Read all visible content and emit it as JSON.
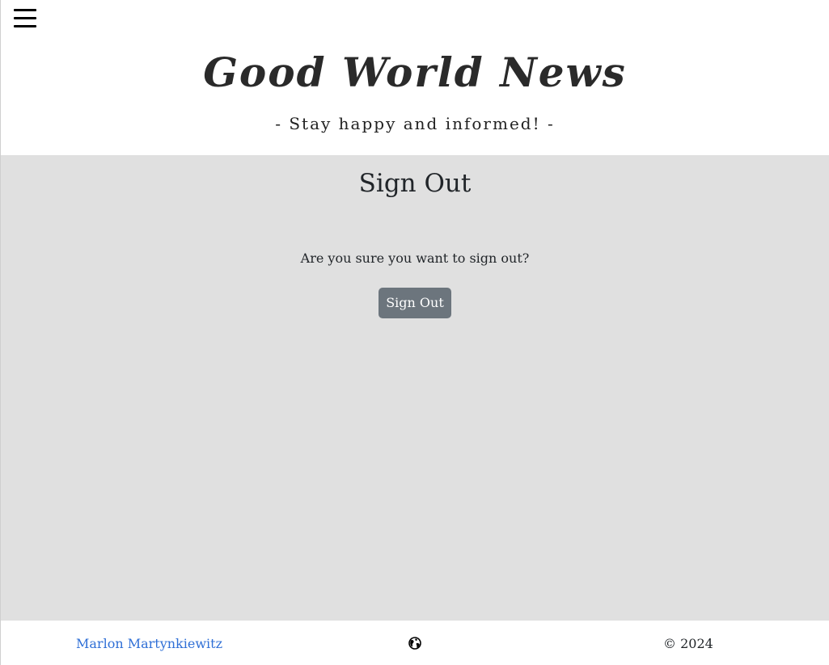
{
  "header": {
    "site_title": "Good World News",
    "tagline": "- Stay happy and informed! -",
    "menu_icon": "hamburger-menu-icon"
  },
  "main": {
    "page_title": "Sign Out",
    "confirm_text": "Are you sure you want to sign out?",
    "signout_button_label": "Sign Out",
    "background_color": "#e0e0e0",
    "button_color": "#6c757d"
  },
  "footer": {
    "author_name": "Marlon Martynkiewitz",
    "center_icon": "globe-icon",
    "copyright": "© 2024",
    "link_color": "#2f6fd6"
  }
}
